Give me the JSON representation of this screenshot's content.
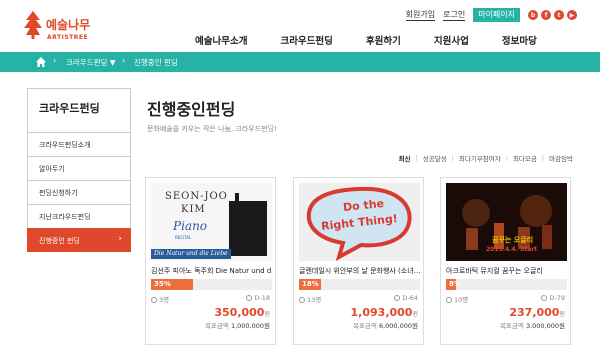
{
  "brand": {
    "name": "예술나무",
    "sub": "ARTISTREE",
    "color": "#e0482b",
    "accent": "#26b3a6"
  },
  "toplinks": {
    "join": "회원가입",
    "login": "로그인",
    "mypage": "마이페이지"
  },
  "social": [
    "blog-icon",
    "facebook-icon",
    "twitter-icon",
    "youtube-icon"
  ],
  "gnb": [
    "예술나무소개",
    "크라우드펀딩",
    "후원하기",
    "지원사업",
    "정보마당"
  ],
  "breadcrumb": {
    "level1": "크라우드펀딩 ▼",
    "level2": "진행중인 펀딩"
  },
  "sidebar": {
    "title": "크라우드펀딩",
    "items": [
      {
        "label": "크라우드펀딩소개"
      },
      {
        "label": "알아두기"
      },
      {
        "label": "펀딩신청하기"
      },
      {
        "label": "지난크라우드펀딩"
      },
      {
        "label": "진행중인 펀딩",
        "active": true
      }
    ]
  },
  "main": {
    "title": "진행중인펀딩",
    "subtitle": "문화예술을 키우는 작은 나눔, 크라우드펀딩!",
    "sort": [
      "최신",
      "성공달성",
      "최다기부참여자",
      "최다모금",
      "마감임박"
    ]
  },
  "cards": [
    {
      "title": "김선주 피아노 독주회 Die Natur und d…",
      "percent": "35%",
      "progress": 0.35,
      "people": "3명",
      "dday": "D-18",
      "amount": "350,000",
      "won": "원",
      "goal_label": "목표금액",
      "goal": "1,000,000원"
    },
    {
      "title": "글렌데일시 위안부의 날 문화행사 (소녀…",
      "percent": "18%",
      "progress": 0.18,
      "people": "13명",
      "dday": "D-64",
      "amount": "1,093,000",
      "won": "원",
      "goal_label": "목표금액",
      "goal": "6,000,000원"
    },
    {
      "title": "아크로바틱 뮤지컬 꿈꾸는 오글리",
      "percent": "8%",
      "progress": 0.08,
      "people": "10명",
      "dday": "D-79",
      "amount": "237,000",
      "won": "원",
      "goal_label": "목표금액",
      "goal": "3,000,000원"
    }
  ],
  "card_images": {
    "card1": {
      "line1": "SEON-JOO",
      "line2": "KIM",
      "line3": "Piano",
      "line4": "RECITAL",
      "line5": "Die Natur und die Liebe"
    },
    "card2": {
      "line1": "Do the",
      "line2": "Right Thing!"
    },
    "card3": {
      "line1": "꿈꾸는 오글리",
      "line2": "2015.4.4. Start"
    }
  }
}
